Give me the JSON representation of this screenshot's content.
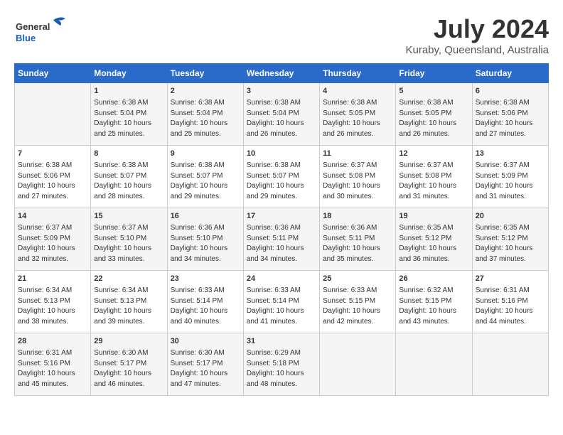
{
  "header": {
    "logo_line1": "General",
    "logo_line2": "Blue",
    "month_title": "July 2024",
    "location": "Kuraby, Queensland, Australia"
  },
  "weekdays": [
    "Sunday",
    "Monday",
    "Tuesday",
    "Wednesday",
    "Thursday",
    "Friday",
    "Saturday"
  ],
  "weeks": [
    [
      {
        "day": "",
        "content": ""
      },
      {
        "day": "1",
        "content": "Sunrise: 6:38 AM\nSunset: 5:04 PM\nDaylight: 10 hours\nand 25 minutes."
      },
      {
        "day": "2",
        "content": "Sunrise: 6:38 AM\nSunset: 5:04 PM\nDaylight: 10 hours\nand 25 minutes."
      },
      {
        "day": "3",
        "content": "Sunrise: 6:38 AM\nSunset: 5:04 PM\nDaylight: 10 hours\nand 26 minutes."
      },
      {
        "day": "4",
        "content": "Sunrise: 6:38 AM\nSunset: 5:05 PM\nDaylight: 10 hours\nand 26 minutes."
      },
      {
        "day": "5",
        "content": "Sunrise: 6:38 AM\nSunset: 5:05 PM\nDaylight: 10 hours\nand 26 minutes."
      },
      {
        "day": "6",
        "content": "Sunrise: 6:38 AM\nSunset: 5:06 PM\nDaylight: 10 hours\nand 27 minutes."
      }
    ],
    [
      {
        "day": "7",
        "content": "Sunrise: 6:38 AM\nSunset: 5:06 PM\nDaylight: 10 hours\nand 27 minutes."
      },
      {
        "day": "8",
        "content": "Sunrise: 6:38 AM\nSunset: 5:07 PM\nDaylight: 10 hours\nand 28 minutes."
      },
      {
        "day": "9",
        "content": "Sunrise: 6:38 AM\nSunset: 5:07 PM\nDaylight: 10 hours\nand 29 minutes."
      },
      {
        "day": "10",
        "content": "Sunrise: 6:38 AM\nSunset: 5:07 PM\nDaylight: 10 hours\nand 29 minutes."
      },
      {
        "day": "11",
        "content": "Sunrise: 6:37 AM\nSunset: 5:08 PM\nDaylight: 10 hours\nand 30 minutes."
      },
      {
        "day": "12",
        "content": "Sunrise: 6:37 AM\nSunset: 5:08 PM\nDaylight: 10 hours\nand 31 minutes."
      },
      {
        "day": "13",
        "content": "Sunrise: 6:37 AM\nSunset: 5:09 PM\nDaylight: 10 hours\nand 31 minutes."
      }
    ],
    [
      {
        "day": "14",
        "content": "Sunrise: 6:37 AM\nSunset: 5:09 PM\nDaylight: 10 hours\nand 32 minutes."
      },
      {
        "day": "15",
        "content": "Sunrise: 6:37 AM\nSunset: 5:10 PM\nDaylight: 10 hours\nand 33 minutes."
      },
      {
        "day": "16",
        "content": "Sunrise: 6:36 AM\nSunset: 5:10 PM\nDaylight: 10 hours\nand 34 minutes."
      },
      {
        "day": "17",
        "content": "Sunrise: 6:36 AM\nSunset: 5:11 PM\nDaylight: 10 hours\nand 34 minutes."
      },
      {
        "day": "18",
        "content": "Sunrise: 6:36 AM\nSunset: 5:11 PM\nDaylight: 10 hours\nand 35 minutes."
      },
      {
        "day": "19",
        "content": "Sunrise: 6:35 AM\nSunset: 5:12 PM\nDaylight: 10 hours\nand 36 minutes."
      },
      {
        "day": "20",
        "content": "Sunrise: 6:35 AM\nSunset: 5:12 PM\nDaylight: 10 hours\nand 37 minutes."
      }
    ],
    [
      {
        "day": "21",
        "content": "Sunrise: 6:34 AM\nSunset: 5:13 PM\nDaylight: 10 hours\nand 38 minutes."
      },
      {
        "day": "22",
        "content": "Sunrise: 6:34 AM\nSunset: 5:13 PM\nDaylight: 10 hours\nand 39 minutes."
      },
      {
        "day": "23",
        "content": "Sunrise: 6:33 AM\nSunset: 5:14 PM\nDaylight: 10 hours\nand 40 minutes."
      },
      {
        "day": "24",
        "content": "Sunrise: 6:33 AM\nSunset: 5:14 PM\nDaylight: 10 hours\nand 41 minutes."
      },
      {
        "day": "25",
        "content": "Sunrise: 6:33 AM\nSunset: 5:15 PM\nDaylight: 10 hours\nand 42 minutes."
      },
      {
        "day": "26",
        "content": "Sunrise: 6:32 AM\nSunset: 5:15 PM\nDaylight: 10 hours\nand 43 minutes."
      },
      {
        "day": "27",
        "content": "Sunrise: 6:31 AM\nSunset: 5:16 PM\nDaylight: 10 hours\nand 44 minutes."
      }
    ],
    [
      {
        "day": "28",
        "content": "Sunrise: 6:31 AM\nSunset: 5:16 PM\nDaylight: 10 hours\nand 45 minutes."
      },
      {
        "day": "29",
        "content": "Sunrise: 6:30 AM\nSunset: 5:17 PM\nDaylight: 10 hours\nand 46 minutes."
      },
      {
        "day": "30",
        "content": "Sunrise: 6:30 AM\nSunset: 5:17 PM\nDaylight: 10 hours\nand 47 minutes."
      },
      {
        "day": "31",
        "content": "Sunrise: 6:29 AM\nSunset: 5:18 PM\nDaylight: 10 hours\nand 48 minutes."
      },
      {
        "day": "",
        "content": ""
      },
      {
        "day": "",
        "content": ""
      },
      {
        "day": "",
        "content": ""
      }
    ]
  ]
}
